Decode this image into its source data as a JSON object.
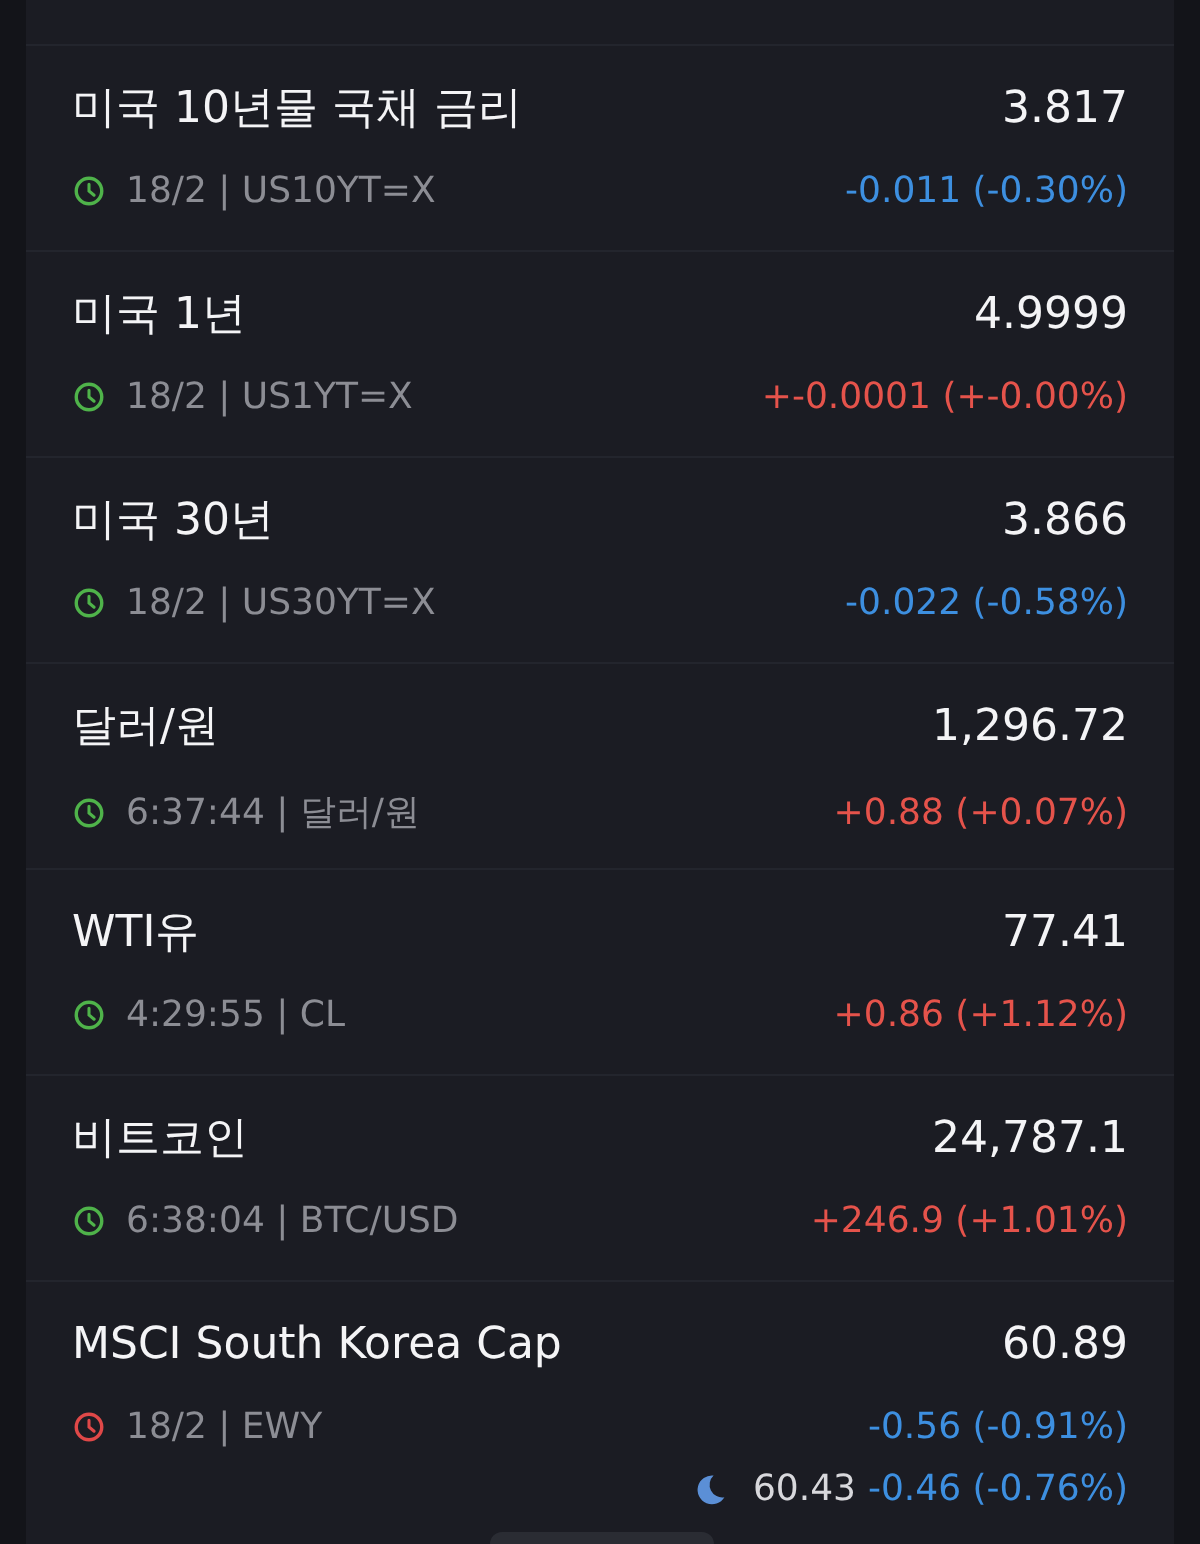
{
  "quotes": [
    {
      "name": "미국 10년물 국채 금리",
      "price": "3.817",
      "meta": "18/2 | US10YT=X",
      "market_open": true,
      "color": "#3d8fe0",
      "change": "-0.011 (-0.30%)"
    },
    {
      "name": "미국 1년",
      "price": "4.9999",
      "meta": "18/2 | US1YT=X",
      "market_open": true,
      "color": "#e5534b",
      "change": "+-0.0001 (+-0.00%)"
    },
    {
      "name": "미국 30년",
      "price": "3.866",
      "meta": "18/2 | US30YT=X",
      "market_open": true,
      "color": "#3d8fe0",
      "change": "-0.022 (-0.58%)"
    },
    {
      "name": "달러/원",
      "price": "1,296.72",
      "meta": "6:37:44 | 달러/원",
      "market_open": true,
      "color": "#e5534b",
      "change": "+0.88 (+0.07%)"
    },
    {
      "name": "WTI유",
      "price": "77.41",
      "meta": "4:29:55 | CL",
      "market_open": true,
      "color": "#e5534b",
      "change": "+0.86 (+1.12%)"
    },
    {
      "name": "비트코인",
      "price": "24,787.1",
      "meta": "6:38:04 | BTC/USD",
      "market_open": true,
      "color": "#e5534b",
      "change": "+246.9 (+1.01%)"
    },
    {
      "name": "MSCI South Korea Cap",
      "price": "60.89",
      "meta": "18/2 | EWY",
      "market_open": false,
      "color": "#3d8fe0",
      "change": "-0.56 (-0.91%)",
      "after_hours": {
        "price": "60.43",
        "color": "#3d8fe0",
        "change": "-0.46 (-0.76%)"
      }
    }
  ]
}
